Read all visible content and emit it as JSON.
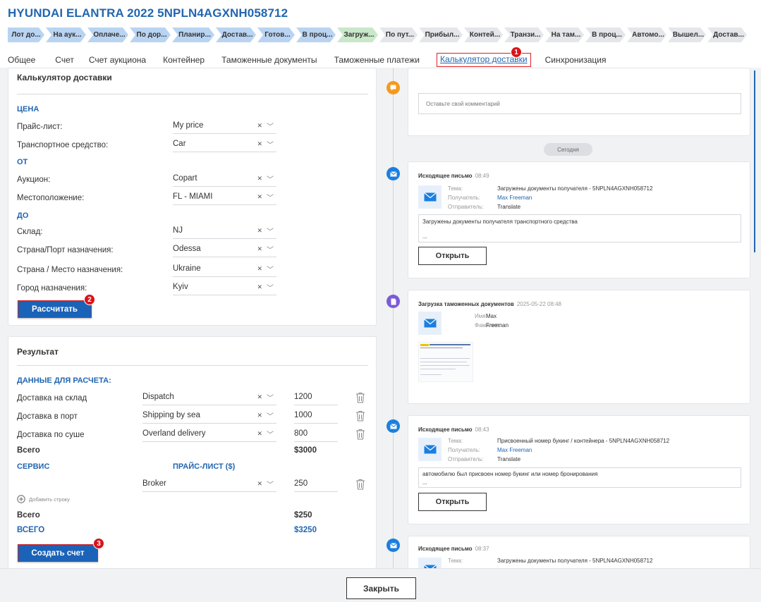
{
  "title": "HYUNDAI ELANTRA 2022 5NPLN4AGXNH058712",
  "stages": [
    {
      "label": "Лот до...",
      "color": "blue"
    },
    {
      "label": "На аук...",
      "color": "blue"
    },
    {
      "label": "Оплаче...",
      "color": "blue"
    },
    {
      "label": "По дор...",
      "color": "blue"
    },
    {
      "label": "Планир...",
      "color": "blue"
    },
    {
      "label": "Достав...",
      "color": "blue"
    },
    {
      "label": "Готов...",
      "color": "blue"
    },
    {
      "label": "В проц...",
      "color": "blue"
    },
    {
      "label": "Загруж...",
      "color": "green"
    },
    {
      "label": "По пут...",
      "color": "gray"
    },
    {
      "label": "Прибыл...",
      "color": "gray"
    },
    {
      "label": "Контей...",
      "color": "gray"
    },
    {
      "label": "Транзи...",
      "color": "gray"
    },
    {
      "label": "На там...",
      "color": "gray"
    },
    {
      "label": "В проц...",
      "color": "gray"
    },
    {
      "label": "Автомо...",
      "color": "gray"
    },
    {
      "label": "Вышел...",
      "color": "gray"
    },
    {
      "label": "Достав...",
      "color": "gray"
    }
  ],
  "tabs": [
    "Общее",
    "Счет",
    "Счет аукциона",
    "Контейнер",
    "Таможенные документы",
    "Таможенные платежи",
    "Калькулятор доставки",
    "Синхронизация"
  ],
  "active_tab": "Калькулятор доставки",
  "badges": {
    "b1": "1",
    "b2": "2",
    "b3": "3"
  },
  "calc": {
    "title": "Калькулятор доставки",
    "price_section": "ЦЕНА",
    "price_list_label": "Прайс-лист:",
    "price_list_value": "My price",
    "vehicle_label": "Транспортное средство:",
    "vehicle_value": "Car",
    "from_section": "ОТ",
    "auction_label": "Аукцион:",
    "auction_value": "Copart",
    "location_label": "Местоположение:",
    "location_value": "FL - MIAMI",
    "to_section": "ДО",
    "warehouse_label": "Склад:",
    "warehouse_value": "NJ",
    "port_label": "Страна/Порт назначения:",
    "port_value": "Odessa",
    "country_label": "Страна / Место назначения:",
    "country_value": "Ukraine",
    "city_label": "Город назначения:",
    "city_value": "Kyiv",
    "calculate_button": "Рассчитать"
  },
  "result": {
    "title": "Результат",
    "data_section": "ДАННЫЕ ДЛЯ РАСЧЕТА:",
    "rows": [
      {
        "label": "Доставка на склад",
        "type": "Dispatch",
        "amount": "1200"
      },
      {
        "label": "Доставка в порт",
        "type": "Shipping by sea",
        "amount": "1000"
      },
      {
        "label": "Доставка по суше",
        "type": "Overland delivery",
        "amount": "800"
      }
    ],
    "subtotal_label": "Всего",
    "subtotal_value": "$3000",
    "service_section": "СЕРВИС",
    "pricelist_section": "ПРАЙС-ЛИСТ ($)",
    "service_row": {
      "type": "Broker",
      "amount": "250"
    },
    "add_row": "Добавить строку",
    "service_total_label": "Всего",
    "service_total_value": "$250",
    "grand_total_label": "ВСЕГО",
    "grand_total_value": "$3250",
    "create_invoice_button": "Создать счет"
  },
  "timeline": {
    "comment_placeholder": "Оставьте свой комментарий",
    "today": "Сегодня",
    "events": [
      {
        "title": "Исходящее письмо",
        "time": "08:49",
        "k1": "Тема:",
        "v1": "Загружены документы получателя - 5NPLN4AGXNH058712",
        "k2": "Получатель:",
        "v2": "Max Freeman",
        "k3": "Отправитель:",
        "v3": "Translate",
        "message": "Загружены документы получателя транспортного средства",
        "ellipsis": "...",
        "button": "Открыть"
      },
      {
        "title": "Загрузка таможенных документов",
        "time": "2025-05-22 08:48",
        "k1": "Имя:",
        "v1": "Max",
        "k2": "Фамилия:",
        "v2": "Freeman"
      },
      {
        "title": "Исходящее письмо",
        "time": "08:43",
        "k1": "Тема:",
        "v1": "Присвоенный номер букинг / контейнера - 5NPLN4AGXNH058712",
        "k2": "Получатель:",
        "v2": "Max Freeman",
        "k3": "Отправитель:",
        "v3": "Translate",
        "message": "автомобилю был присвоен номер букинг или номер бронирования",
        "ellipsis": "...",
        "button": "Открыть"
      },
      {
        "title": "Исходящее письмо",
        "time": "08:37",
        "k1": "Тема:",
        "v1": "Загружены документы получателя - 5NPLN4AGXNH058712"
      }
    ]
  },
  "close_button": "Закрыть",
  "colors": {
    "accent": "#2266b0",
    "button": "#1a63b8",
    "badge": "#d9141b",
    "orange": "#f39a1d",
    "purple": "#7b5cd6"
  }
}
